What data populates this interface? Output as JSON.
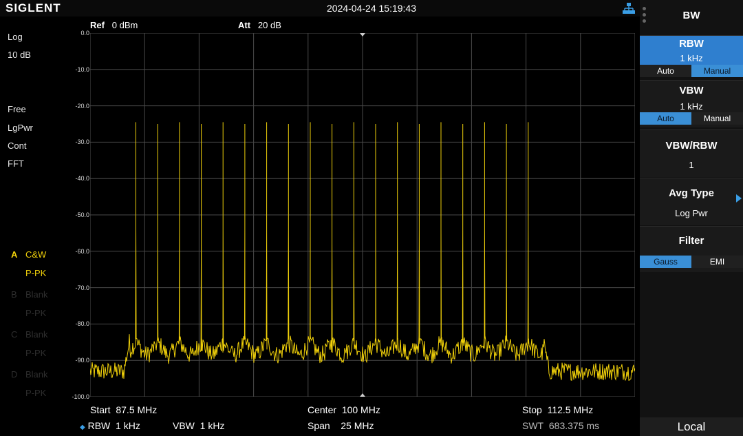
{
  "header": {
    "brand": "SIGLENT",
    "datetime": "2024-04-24 15:19:43",
    "network_icon": "network-icon"
  },
  "left_panel": {
    "scale_type": "Log",
    "scale_div": "10 dB",
    "trigger": "Free",
    "avg_type": "LgPwr",
    "sweep_mode": "Cont",
    "sweep_type": "FFT",
    "traces": [
      {
        "letter": "A",
        "mode": "C&W",
        "detector": "P-PK",
        "active": true
      },
      {
        "letter": "B",
        "mode": "Blank",
        "detector": "P-PK",
        "active": false
      },
      {
        "letter": "C",
        "mode": "Blank",
        "detector": "P-PK",
        "active": false
      },
      {
        "letter": "D",
        "mode": "Blank",
        "detector": "P-PK",
        "active": false
      }
    ]
  },
  "plot_header": {
    "ref_label": "Ref",
    "ref_value": "0 dBm",
    "att_label": "Att",
    "att_value": "20 dB"
  },
  "bottom": {
    "start_label": "Start",
    "start_value": "87.5 MHz",
    "center_label": "Center",
    "center_value": "100 MHz",
    "stop_label": "Stop",
    "stop_value": "112.5 MHz",
    "rbw_label": "RBW",
    "rbw_value": "1 kHz",
    "vbw_label": "VBW",
    "vbw_value": "1 kHz",
    "span_label": "Span",
    "span_value": "25 MHz",
    "swt_label": "SWT",
    "swt_value": "683.375 ms"
  },
  "right_panel": {
    "title": "BW",
    "rbw": {
      "label": "RBW",
      "value": "1 kHz",
      "options": [
        "Auto",
        "Manual"
      ],
      "selected": "Manual"
    },
    "vbw": {
      "label": "VBW",
      "value": "1 kHz",
      "options": [
        "Auto",
        "Manual"
      ],
      "selected": "Auto"
    },
    "vbw_rbw": {
      "label": "VBW/RBW",
      "value": "1"
    },
    "avg_type": {
      "label": "Avg Type",
      "value": "Log Pwr"
    },
    "filter": {
      "label": "Filter",
      "options": [
        "Gauss",
        "EMI"
      ],
      "selected": "Gauss"
    },
    "local": "Local"
  },
  "colors": {
    "trace": "#f1d10a",
    "grid": "#4a4a4a",
    "accent": "#3a8fd6"
  },
  "chart_data": {
    "type": "line",
    "xlabel": "",
    "ylabel": "",
    "x_unit": "MHz",
    "y_unit": "dBm",
    "xlim": [
      87.5,
      112.5
    ],
    "ylim": [
      -100,
      0
    ],
    "y_ticks": [
      "0.0",
      "-10.0",
      "-20.0",
      "-30.0",
      "-40.0",
      "-50.0",
      "-60.0",
      "-70.0",
      "-80.0",
      "-90.0",
      "-100.0"
    ],
    "grid": true,
    "x_divisions": 10,
    "y_divisions": 10,
    "noise_floor_outside": -93,
    "noise_floor_inside": -85,
    "occupied_band": [
      89.3,
      108.3
    ],
    "series": [
      {
        "values": [
          {
            "freq": 89.6,
            "peak": -24.5,
            "mid": -54
          },
          {
            "freq": 90.6,
            "peak": -25,
            "mid": -58
          },
          {
            "freq": 91.6,
            "peak": -24.5,
            "mid": -54
          },
          {
            "freq": 92.6,
            "peak": -25,
            "mid": -58
          },
          {
            "freq": 93.6,
            "peak": -24.5,
            "mid": -54
          },
          {
            "freq": 94.6,
            "peak": -25,
            "mid": -54
          },
          {
            "freq": 95.6,
            "peak": -24.5,
            "mid": -54
          },
          {
            "freq": 96.6,
            "peak": -25,
            "mid": -54
          },
          {
            "freq": 97.6,
            "peak": -24.5,
            "mid": -54
          },
          {
            "freq": 98.6,
            "peak": -25,
            "mid": -58
          },
          {
            "freq": 99.6,
            "peak": -24.5,
            "mid": -54
          },
          {
            "freq": 100.6,
            "peak": -25,
            "mid": -54
          },
          {
            "freq": 101.6,
            "peak": -24.5,
            "mid": -54
          },
          {
            "freq": 102.6,
            "peak": -25,
            "mid": -54
          },
          {
            "freq": 103.6,
            "peak": -24.5,
            "mid": -54
          },
          {
            "freq": 104.6,
            "peak": -25,
            "mid": -54
          },
          {
            "freq": 105.6,
            "peak": -24.5,
            "mid": -54
          },
          {
            "freq": 106.6,
            "peak": -25,
            "mid": -58
          },
          {
            "freq": 107.6,
            "peak": -24.5,
            "mid": -54
          }
        ]
      }
    ]
  }
}
